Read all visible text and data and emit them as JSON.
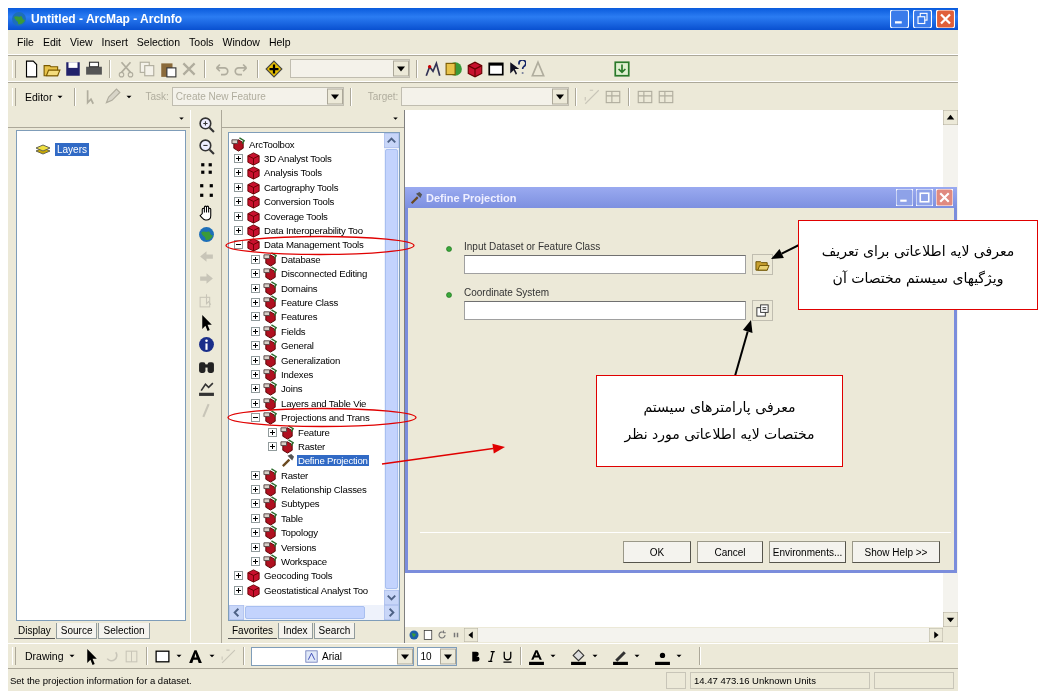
{
  "window": {
    "title": "Untitled - ArcMap - ArcInfo"
  },
  "menu": [
    "File",
    "Edit",
    "View",
    "Insert",
    "Selection",
    "Tools",
    "Window",
    "Help"
  ],
  "editor_toolbar": {
    "editor": "Editor",
    "task": {
      "label": "Task:",
      "value": "Create New Feature",
      "disabled": true
    },
    "target": {
      "label": "Target:",
      "disabled": true
    }
  },
  "toc": {
    "root": {
      "label": "Layers",
      "selected": true
    },
    "tabs": [
      {
        "label": "Display",
        "selected": true
      },
      {
        "label": "Source",
        "selected": false
      },
      {
        "label": "Selection",
        "selected": false
      }
    ]
  },
  "toolbox": {
    "root": "ArcToolbox",
    "items": [
      {
        "label": "3D Analyst Tools",
        "kind": "toolbox",
        "expanded": false,
        "selected": false
      },
      {
        "label": "Analysis Tools",
        "kind": "toolbox",
        "expanded": false,
        "selected": false
      },
      {
        "label": "Cartography Tools",
        "kind": "toolbox",
        "expanded": false,
        "selected": false
      },
      {
        "label": "Conversion Tools",
        "kind": "toolbox",
        "expanded": false,
        "selected": false
      },
      {
        "label": "Coverage Tools",
        "kind": "toolbox",
        "expanded": false,
        "selected": false
      },
      {
        "label": "Data Interoperability Too",
        "kind": "toolbox",
        "expanded": false,
        "selected": false
      },
      {
        "label": "Data Management Tools",
        "kind": "toolbox",
        "expanded": true,
        "selected": false,
        "children": [
          {
            "label": "Database",
            "kind": "toolset",
            "expanded": false,
            "selected": false
          },
          {
            "label": "Disconnected Editing",
            "kind": "toolset",
            "expanded": false,
            "selected": false
          },
          {
            "label": "Domains",
            "kind": "toolset",
            "expanded": false,
            "selected": false
          },
          {
            "label": "Feature Class",
            "kind": "toolset",
            "expanded": false,
            "selected": false
          },
          {
            "label": "Features",
            "kind": "toolset",
            "expanded": false,
            "selected": false
          },
          {
            "label": "Fields",
            "kind": "toolset",
            "expanded": false,
            "selected": false
          },
          {
            "label": "General",
            "kind": "toolset",
            "expanded": false,
            "selected": false
          },
          {
            "label": "Generalization",
            "kind": "toolset",
            "expanded": false,
            "selected": false
          },
          {
            "label": "Indexes",
            "kind": "toolset",
            "expanded": false,
            "selected": false
          },
          {
            "label": "Joins",
            "kind": "toolset",
            "expanded": false,
            "selected": false
          },
          {
            "label": "Layers and Table Vie",
            "kind": "toolset",
            "expanded": false,
            "selected": false
          },
          {
            "label": "Projections and Trans",
            "kind": "toolset",
            "expanded": true,
            "selected": false,
            "children": [
              {
                "label": "Feature",
                "kind": "toolset",
                "expanded": false,
                "selected": false
              },
              {
                "label": "Raster",
                "kind": "toolset",
                "expanded": false,
                "selected": false
              },
              {
                "label": "Define Projection",
                "kind": "tool",
                "selected": true
              }
            ]
          },
          {
            "label": "Raster",
            "kind": "toolset",
            "expanded": false,
            "selected": false
          },
          {
            "label": "Relationship Classes",
            "kind": "toolset",
            "expanded": false,
            "selected": false
          },
          {
            "label": "Subtypes",
            "kind": "toolset",
            "expanded": false,
            "selected": false
          },
          {
            "label": "Table",
            "kind": "toolset",
            "expanded": false,
            "selected": false
          },
          {
            "label": "Topology",
            "kind": "toolset",
            "expanded": false,
            "selected": false
          },
          {
            "label": "Versions",
            "kind": "toolset",
            "expanded": false,
            "selected": false
          },
          {
            "label": "Workspace",
            "kind": "toolset",
            "expanded": false,
            "selected": false
          }
        ]
      },
      {
        "label": "Geocoding Tools",
        "kind": "toolbox",
        "expanded": false,
        "selected": false
      },
      {
        "label": "Geostatistical Analyst Too",
        "kind": "toolbox",
        "expanded": false,
        "selected": false
      }
    ],
    "tabs": [
      {
        "label": "Favorites",
        "selected": true
      },
      {
        "label": "Index",
        "selected": false
      },
      {
        "label": "Search",
        "selected": false
      }
    ]
  },
  "dialog": {
    "title": "Define Projection",
    "fields": [
      {
        "label": "Input Dataset or Feature Class",
        "kind": "dataset"
      },
      {
        "label": "Coordinate System",
        "kind": "coordinate_system"
      }
    ],
    "buttons": [
      "OK",
      "Cancel",
      "Environments...",
      "Show Help >>"
    ]
  },
  "drawing_toolbar": {
    "menu": "Drawing",
    "font": "Arial",
    "font_size": "10"
  },
  "status_bar": {
    "message": "Set the projection information for a dataset.",
    "coordinates": "14.47  473.16 Unknown Units"
  },
  "annotations": [
    {
      "lines": [
        "معرفی لایه اطلاعاتی برای تعریف",
        "ویژگیهای سیستم مختصات آن"
      ]
    },
    {
      "lines": [
        "معرفی پارامترهای سیستم",
        "مختصات لایه اطلاعاتی مورد نظر"
      ]
    }
  ]
}
